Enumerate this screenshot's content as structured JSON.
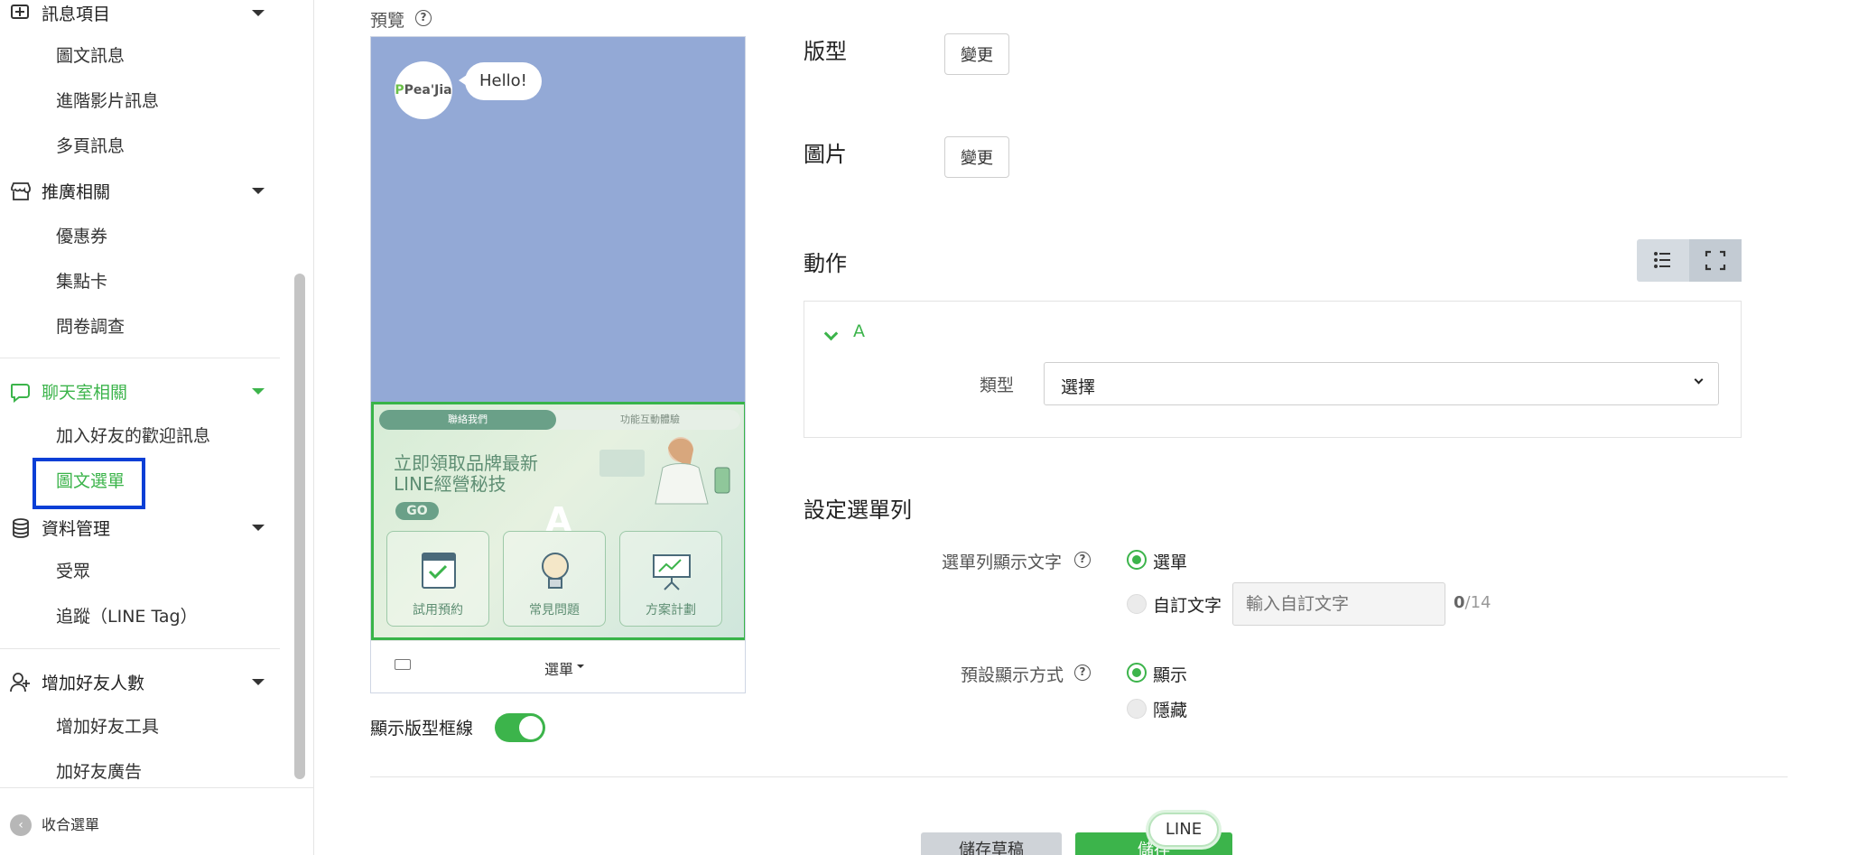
{
  "sidebar": {
    "group_message": "訊息項目",
    "items_message": [
      "圖文訊息",
      "進階影片訊息",
      "多頁訊息"
    ],
    "group_promo": "推廣相關",
    "items_promo": [
      "優惠券",
      "集點卡",
      "問卷調查"
    ],
    "group_chat": "聊天室相關",
    "items_chat": [
      "加入好友的歡迎訊息",
      "圖文選單"
    ],
    "group_data": "資料管理",
    "items_data": [
      "受眾",
      "追蹤（LINE Tag）"
    ],
    "group_friends": "增加好友人數",
    "items_friends": [
      "增加好友工具",
      "加好友廣告"
    ],
    "collapse_label": "收合選單"
  },
  "preview": {
    "label": "預覽",
    "help": "?",
    "avatar_text_green": "P",
    "avatar_text": "Pea'Jia",
    "bubble": "Hello!",
    "richmenu": {
      "tab_active": "聯絡我們",
      "tab_inactive": "功能互動體驗",
      "title": "立即領取品牌最新LINE經營秘技",
      "go": "GO",
      "area_letter": "A",
      "cards": [
        "試用預約",
        "常見問題",
        "方案計劃"
      ]
    },
    "menu_bar_text": "選單",
    "show_border_label": "顯示版型框線"
  },
  "form": {
    "layout_title": "版型",
    "image_title": "圖片",
    "change_button": "變更",
    "action_title": "動作",
    "action": {
      "letter": "A",
      "type_label": "類型",
      "type_value": "選擇"
    },
    "menubar_title": "設定選單列",
    "menubar_text_label": "選單列顯示文字",
    "opt_menu": "選單",
    "opt_custom": "自訂文字",
    "custom_placeholder": "輸入自訂文字",
    "counter_current": "0",
    "counter_max": "/14",
    "default_display_label": "預設顯示方式",
    "opt_show": "顯示",
    "opt_hide": "隱藏",
    "btn_draft": "儲存草稿",
    "btn_save": "儲存",
    "line_bubble": "LINE"
  },
  "colors": {
    "accent": "#3cb44b",
    "highlight": "#0a3fd6",
    "chat_bg": "#93a9d6"
  }
}
